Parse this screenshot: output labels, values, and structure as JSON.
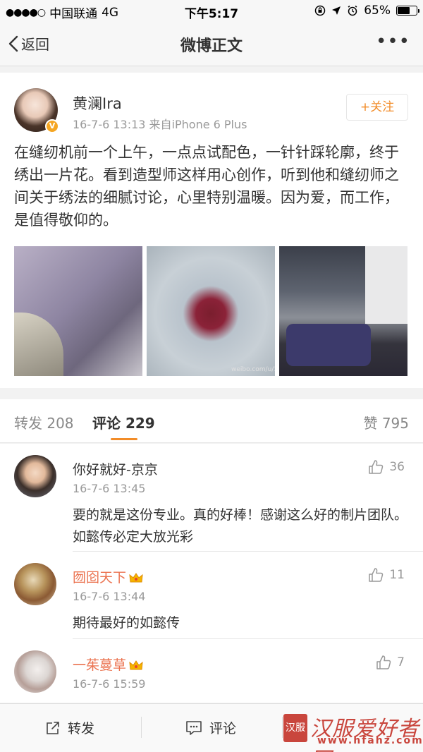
{
  "status_bar": {
    "signal": "●●●●○",
    "carrier": "中国联通",
    "network": "4G",
    "time": "下午5:17",
    "battery": "65%",
    "battery_level": 0.65
  },
  "nav": {
    "back_label": "返回",
    "title": "微博正文",
    "more_label": "•••"
  },
  "post": {
    "author": "黄澜Ira",
    "meta": "16-7-6 13:13  来自iPhone 6 Plus",
    "follow_label": "+关注",
    "text": "在缝纫机前一个上午，一点点试配色，一针针踩轮廓，终于绣出一片花。看到造型师这样用心创作，听到他和缝纫师之间关于绣法的细腻讨论，心里特别温暖。因为爱，而工作，是值得敬仰的。",
    "image_watermark": "weibo.com/u/140"
  },
  "tabs": {
    "repost": "转发 208",
    "comment": "评论 229",
    "like": "赞 795"
  },
  "comments": [
    {
      "name": "你好就好-京京",
      "time": "16-7-6 13:45",
      "likes": "36",
      "text": "要的就是这份专业。真的好棒！感谢这么好的制片团队。如懿传必定大放光彩"
    },
    {
      "name": "囫囵天下",
      "time": "16-7-6 13:44",
      "likes": "11",
      "text": "期待最好的如懿传"
    },
    {
      "name": "一茱蔓草",
      "time": "16-7-6 15:59",
      "likes": "7",
      "text": ""
    }
  ],
  "toolbar": {
    "repost_label": "转发",
    "comment_label": "评论"
  },
  "watermark": {
    "stamp": "汉服",
    "site_name": "汉服爱好者网",
    "site_url": "www.hfahz.com"
  }
}
